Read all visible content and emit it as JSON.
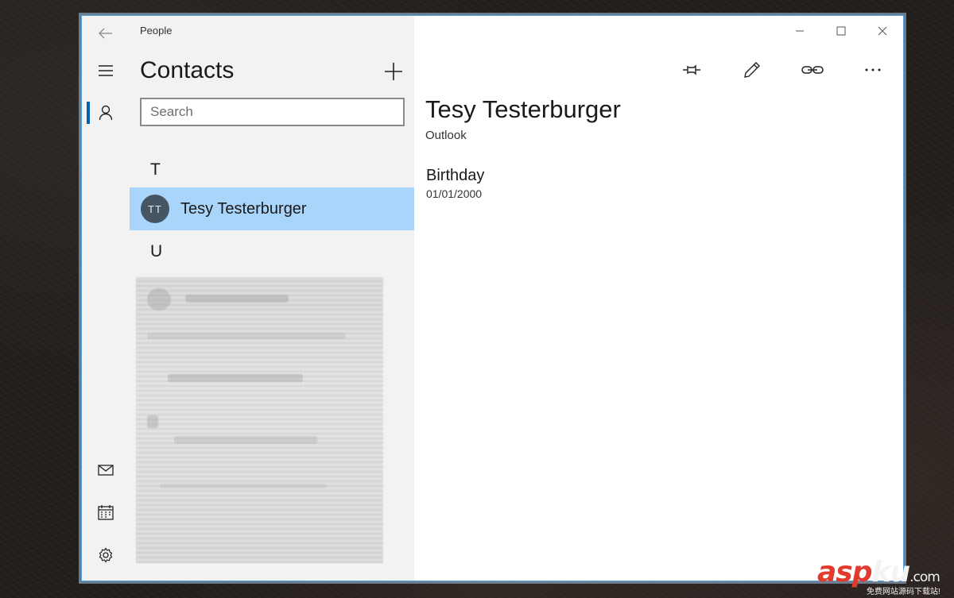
{
  "window": {
    "title": "People",
    "controls": [
      "minimize",
      "maximize",
      "close"
    ]
  },
  "nav": {
    "items": [
      {
        "icon": "back-arrow-icon"
      },
      {
        "icon": "hamburger-menu-icon"
      },
      {
        "icon": "person-icon",
        "active": true
      },
      {
        "icon": "mail-icon"
      },
      {
        "icon": "calendar-icon"
      },
      {
        "icon": "settings-gear-icon"
      }
    ]
  },
  "contacts": {
    "header": "Contacts",
    "search_placeholder": "Search",
    "groups": [
      {
        "letter": "T",
        "items": [
          {
            "initials": "TT",
            "name": "Tesy Testerburger",
            "selected": true
          }
        ]
      },
      {
        "letter": "U",
        "items": []
      }
    ]
  },
  "toolbar": {
    "buttons": [
      "pin-icon",
      "edit-pencil-icon",
      "link-icon",
      "more-ellipsis-icon"
    ]
  },
  "detail": {
    "name": "Tesy Testerburger",
    "source": "Outlook",
    "fields": [
      {
        "label": "Birthday",
        "value": "01/01/2000"
      }
    ]
  },
  "watermark": {
    "logo_part1": "asp",
    "logo_part2": "ku",
    "logo_suffix": ".com",
    "tagline": "免费网站源码下载站!"
  },
  "colors": {
    "selection": "#a9d5fa",
    "accent": "#0063b1",
    "pane_bg": "#f2f2f2",
    "avatar_bg": "#465563"
  }
}
